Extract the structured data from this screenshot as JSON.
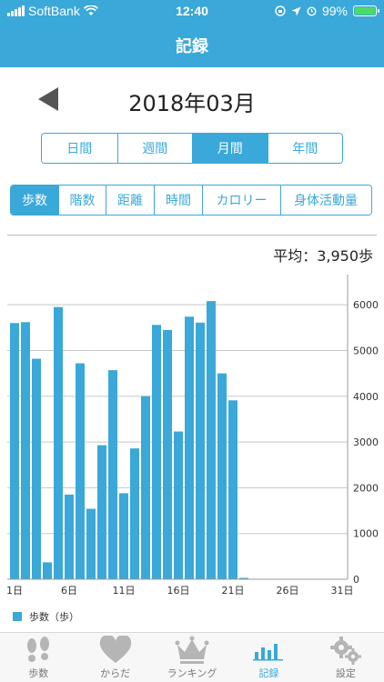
{
  "status_bar": {
    "carrier": "SoftBank",
    "time": "12:40",
    "battery_text": "99%",
    "battery_level": 0.99
  },
  "nav": {
    "title": "記録"
  },
  "month": {
    "label": "2018年03月"
  },
  "period_tabs": [
    {
      "label": "日間",
      "active": false
    },
    {
      "label": "週間",
      "active": false
    },
    {
      "label": "月間",
      "active": true
    },
    {
      "label": "年間",
      "active": false
    }
  ],
  "metric_tabs": [
    {
      "label": "歩数",
      "active": true
    },
    {
      "label": "階数",
      "active": false
    },
    {
      "label": "距離",
      "active": false
    },
    {
      "label": "時間",
      "active": false
    },
    {
      "label": "カロリー",
      "active": false
    },
    {
      "label": "身体活動量",
      "active": false
    }
  ],
  "average": {
    "label": "平均：3,950歩"
  },
  "colors": {
    "accent": "#3aa8d8",
    "grid": "#c8c8c8",
    "text": "#333333"
  },
  "chart_data": {
    "type": "bar",
    "x": [
      1,
      2,
      3,
      4,
      5,
      6,
      7,
      8,
      9,
      10,
      11,
      12,
      13,
      14,
      15,
      16,
      17,
      18,
      19,
      20,
      21,
      22,
      23,
      24,
      25,
      26,
      27,
      28,
      29,
      30,
      31
    ],
    "x_ticks": [
      1,
      6,
      11,
      16,
      21,
      26,
      31
    ],
    "x_tick_labels": [
      "1日",
      "6日",
      "11日",
      "16日",
      "21日",
      "26日",
      "31日"
    ],
    "series": [
      {
        "name": "歩数（歩）",
        "values": [
          5600,
          5620,
          4820,
          370,
          5950,
          1850,
          4720,
          1540,
          2930,
          4570,
          1880,
          2860,
          4000,
          5560,
          5450,
          3230,
          5740,
          5610,
          6080,
          4500,
          3910,
          30,
          0,
          0,
          0,
          0,
          0,
          0,
          0,
          0,
          0
        ]
      }
    ],
    "ylim": [
      0,
      6500
    ],
    "y_ticks": [
      0,
      1000,
      2000,
      3000,
      4000,
      5000,
      6000
    ],
    "y_axis_position": "right",
    "grid": true,
    "legend_position": "bottom-left"
  },
  "tab_bar": [
    {
      "label": "歩数",
      "icon": "footprints-icon",
      "active": false
    },
    {
      "label": "からだ",
      "icon": "heart-icon",
      "active": false
    },
    {
      "label": "ランキング",
      "icon": "crown-icon",
      "active": false
    },
    {
      "label": "記録",
      "icon": "bar-chart-icon",
      "active": true
    },
    {
      "label": "設定",
      "icon": "gears-icon",
      "active": false
    }
  ]
}
